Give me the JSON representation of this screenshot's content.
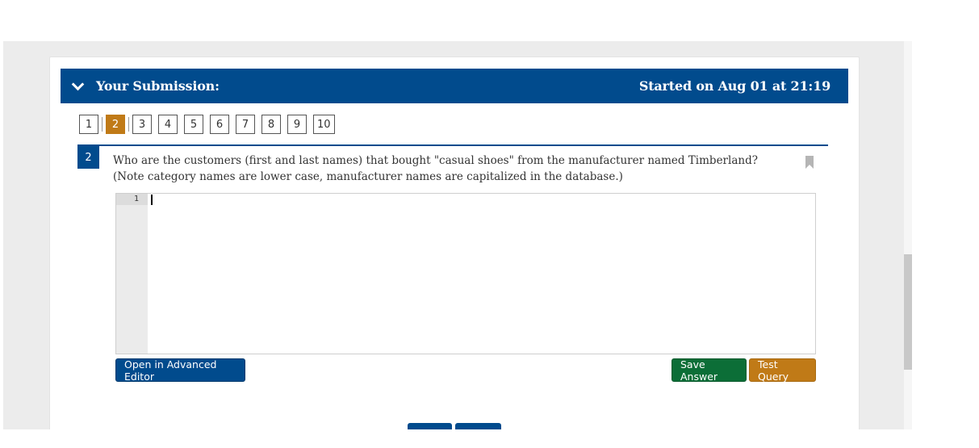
{
  "header": {
    "title": "Your Submission:",
    "started": "Started on Aug 01 at 21:19",
    "collapse_icon": "chevron-down-icon"
  },
  "question_nav": {
    "active": "2",
    "items": [
      "1",
      "2",
      "3",
      "4",
      "5",
      "6",
      "7",
      "8",
      "9",
      "10"
    ]
  },
  "question": {
    "number": "2",
    "text": "Who are the customers (first and last names) that bought \"casual shoes\" from the manufacturer named Timberland? (Note category names are lower case, manufacturer names are capitalized in the database.)",
    "bookmark_icon": "bookmark-icon"
  },
  "editor": {
    "line_number": "1",
    "content": ""
  },
  "buttons": {
    "advanced_editor": "Open in Advanced Editor",
    "save_answer": "Save Answer",
    "test_query": "Test Query"
  },
  "colors": {
    "primary": "#014b8d",
    "accent": "#c07a17",
    "success": "#0c6e37"
  }
}
